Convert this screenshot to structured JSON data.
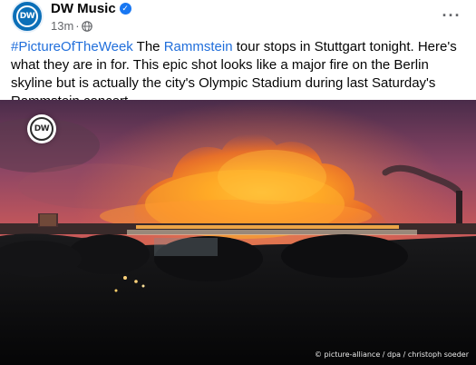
{
  "post": {
    "page_name": "DW Music",
    "avatar_text": "DW",
    "timestamp": "13m",
    "meta_separator": "·",
    "more_label": "···",
    "caption_parts": [
      {
        "text": "#PictureOfTheWeek",
        "link": true
      },
      {
        "text": " The ",
        "link": false
      },
      {
        "text": "Rammstein",
        "link": true
      },
      {
        "text": " tour stops in Stuttgart tonight. Here's what they are in for. This epic shot looks like a major fire on the Berlin skyline but is actually the city's Olympic Stadium during last Saturday's Rammstein concert.",
        "link": false
      }
    ],
    "photo_logo_text": "DW",
    "photo_credit": "© picture-alliance / dpa / christoph soeder"
  },
  "colors": {
    "brand_blue": "#0b6fb8",
    "link_blue": "#216fdb",
    "verified_blue": "#1877f2",
    "meta_gray": "#65676b"
  },
  "icons": {
    "verified": "verified-check-icon",
    "audience": "globe-icon",
    "more": "more-options-icon"
  }
}
